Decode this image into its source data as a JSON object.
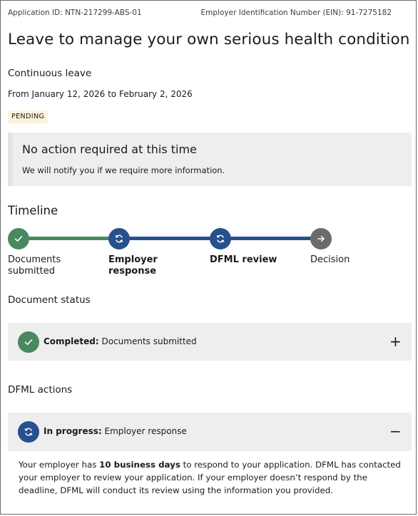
{
  "header": {
    "application_id": "Application ID: NTN-217299-ABS-01",
    "ein": "Employer Identification Number (EIN): 91-7275182"
  },
  "page": {
    "title": "Leave to manage your own serious health condition",
    "leave_type": "Continuous leave",
    "date_range": "From January 12, 2026 to February 2, 2026",
    "status_badge": "PENDING"
  },
  "notice": {
    "title": "No action required at this time",
    "body": "We will notify you if we require more information."
  },
  "timeline": {
    "heading": "Timeline",
    "steps": [
      {
        "line1": "Documents",
        "line2": "submitted",
        "state": "complete",
        "icon": "check-icon"
      },
      {
        "line1": "Employer",
        "line2": "response",
        "state": "in-progress",
        "icon": "refresh-icon"
      },
      {
        "line1": "DFML review",
        "line2": "",
        "state": "in-progress",
        "icon": "refresh-icon"
      },
      {
        "line1": "Decision",
        "line2": "",
        "state": "upcoming",
        "icon": "arrow-right-icon"
      }
    ]
  },
  "document_status": {
    "heading": "Document status",
    "item": {
      "status": "Completed:",
      "text": "Documents submitted",
      "toggle": "+"
    }
  },
  "dfml_actions": {
    "heading": "DFML actions",
    "item": {
      "status": "In progress:",
      "text": "Employer response",
      "toggle": "−"
    },
    "body": {
      "part1": "Your employer has ",
      "bold": "10 business days",
      "part2": " to respond to your application. DFML has contacted your employer to review your application. If your employer doesn’t respond by the deadline, DFML will conduct its review using the information you provided."
    }
  },
  "colors": {
    "complete": "#4a8860",
    "in_progress": "#28508c",
    "upcoming": "#6b6b6b",
    "badge_bg": "#fbf3dc",
    "panel_bg": "#eeeeee"
  }
}
